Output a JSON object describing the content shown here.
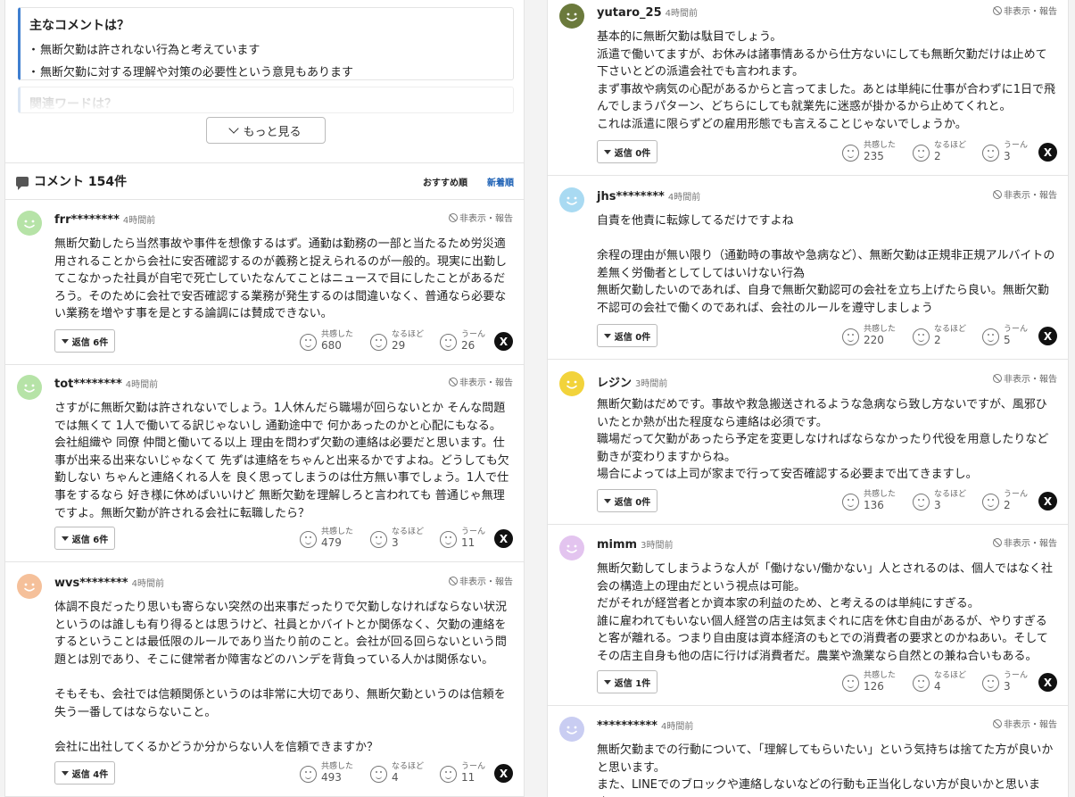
{
  "summary": {
    "heading": "主なコメントは？",
    "points": [
      "無断欠勤は許されない行為と考えています",
      "無断欠勤に対する理解や対策の必要性という意見もあります"
    ]
  },
  "related_heading": "関連ワードは？",
  "more_button": "もっと見る",
  "comments_header": {
    "title": "コメント 154件",
    "sort_recommended": "おすすめ順",
    "sort_newest": "新着順"
  },
  "labels": {
    "report": "非表示・報告",
    "like": "共感した",
    "naruhodo": "なるほど",
    "uun": "うーん",
    "share_x": "X"
  },
  "left_comments": [
    {
      "user": "frr********",
      "time": "4時間前",
      "text": "無断欠勤したら当然事故や事件を想像するはず。通勤は勤務の一部と当たるため労災適用されることから会社に安否確認するのが義務と捉えられるのが一般的。現実に出勤してこなかった社員が自宅で死亡していたなんてことはニュースで目にしたことがあるだろう。そのために会社で安否確認する業務が発生するのは間違いなく、普通なら必要ない業務を増やす事を是とする論調には賛成できない。",
      "reply": "返信 6件",
      "like": "680",
      "naruhodo": "29",
      "uun": "26",
      "avatar_color": "#b6e3a7"
    },
    {
      "user": "tot********",
      "time": "4時間前",
      "text": "さすがに無断欠勤は許されないでしょう。1人休んだら職場が回らないとか そんな問題では無くて 1人で働いてる訳じゃないし 通勤途中で 何かあったのかと心配にもなる。\n会社組織や 同僚 仲間と働いてる以上 理由を問わず欠勤の連絡は必要だと思います。仕事が出来る出来ないじゃなくて 先ずは連絡をちゃんと出来るかですよね。どうしても欠勤しない ちゃんと連絡くれる人を 良く思ってしまうのは仕方無い事でしょう。1人で仕事をするなら 好き様に休めばいいけど 無断欠勤を理解しろと言われても 普通じゃ無理ですよ。無断欠勤が許される会社に転職したら？",
      "reply": "返信 6件",
      "like": "479",
      "naruhodo": "3",
      "uun": "11",
      "avatar_color": "#b6e3a7"
    },
    {
      "user": "wvs********",
      "time": "4時間前",
      "text": "体調不良だったり思いも寄らない突然の出来事だったりで欠勤しなければならない状況というのは誰しも有り得るとは思うけど、社員とかバイトとか関係なく、欠勤の連絡をするということは最低限のルールであり当たり前のこと。会社が回る回らないという問題とは別であり、そこに健常者か障害などのハンデを背負っている人かは関係ない。\n\nそもそも、会社では信頼関係というのは非常に大切であり、無断欠勤というのは信頼を失う一番してはならないこと。\n\n会社に出社してくるかどうか分からない人を信頼できますか？",
      "reply": "返信 4件",
      "like": "493",
      "naruhodo": "4",
      "uun": "11",
      "avatar_color": "#f5c09a"
    }
  ],
  "right_comments": [
    {
      "user": "yutaro_25",
      "time": "4時間前",
      "text": "基本的に無断欠勤は駄目でしょう。\n派遣で働いてますが、お休みは諸事情あるから仕方ないにしても無断欠勤だけは止めて下さいとどの派遣会社でも言われます。\nまず事故や病気の心配があるからと言ってました。あとは単純に仕事が合わずに1日で飛んでしまうパターン、どちらにしても就業先に迷惑が掛かるから止めてくれと。\nこれは派遣に限らずどの雇用形態でも言えることじゃないでしょうか。",
      "reply": "返信 0件",
      "like": "235",
      "naruhodo": "2",
      "uun": "3",
      "avatar_color": "#6b7a3c"
    },
    {
      "user": "jhs********",
      "time": "4時間前",
      "text": "自責を他責に転嫁してるだけですよね\n\n余程の理由が無い限り（通勤時の事故や急病など）、無断欠勤は正規非正規アルバイトの差無く労働者としてしてはいけない行為\n無断欠勤したいのであれば、自身で無断欠勤認可の会社を立ち上げたら良い。無断欠勤不認可の会社で働くのであれば、会社のルールを遵守しましょう",
      "reply": "返信 0件",
      "like": "220",
      "naruhodo": "2",
      "uun": "5",
      "avatar_color": "#a9daf2"
    },
    {
      "user": "レジン",
      "time": "3時間前",
      "text": "無断欠勤はだめです。事故や救急搬送されるような急病なら致し方ないですが、風邪ひいたとか熱が出た程度なら連絡は必須です。\n職場だって欠勤があったら予定を変更しなければならなかったり代役を用意したりなど動きが変わりますからね。\n場合によっては上司が家まで行って安否確認する必要まで出てきますし。",
      "reply": "返信 0件",
      "like": "136",
      "naruhodo": "3",
      "uun": "2",
      "avatar_color": "#f2d33b"
    },
    {
      "user": "mimm",
      "time": "3時間前",
      "text": "無断欠勤してしまうような人が「働けない/働かない」人とされるのは、個人ではなく社会の構造上の理由だという視点は可能。\nだがそれが経営者とか資本家の利益のため、と考えるのは単純にすぎる。\n誰に雇われてもいない個人経営の店主は気まぐれに店を休む自由があるが、やりすぎると客が離れる。つまり自由度は資本経済のもとでの消費者の要求とのかねあい。そしてその店主自身も他の店に行けば消費者だ。農業や漁業なら自然との兼ね合いもある。",
      "reply": "返信 1件",
      "like": "126",
      "naruhodo": "4",
      "uun": "3",
      "avatar_color": "#e3c4ef"
    },
    {
      "user": "**********",
      "time": "4時間前",
      "text": "無断欠勤までの行動について、「理解してもらいたい」という気持ちは捨てた方が良いかと思います。\nまた、LINEでのブロックや連絡しないなどの行動も正当化しない方が良いかと思います。",
      "reply": "",
      "like": "",
      "naruhodo": "",
      "uun": "",
      "avatar_color": "#c9cdf2"
    }
  ]
}
